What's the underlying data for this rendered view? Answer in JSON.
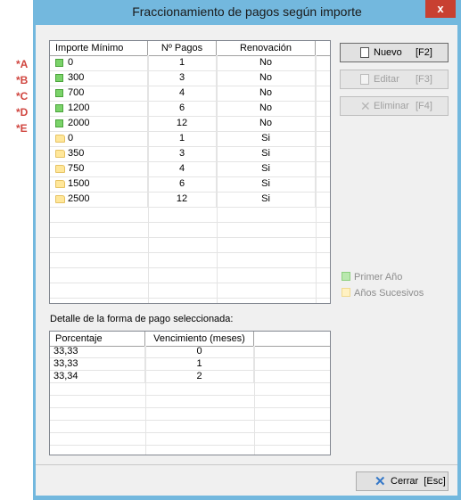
{
  "annotations": [
    "*A",
    "*B",
    "*C",
    "*D",
    "*E"
  ],
  "window": {
    "title": "Fraccionamiento de pagos según importe",
    "close_glyph": "x"
  },
  "plans": {
    "columns": [
      "Importe Mínimo",
      "Nº Pagos",
      "Renovación"
    ],
    "rows": [
      {
        "icon": "green",
        "importe": "0",
        "pagos": "1",
        "renovacion": "No"
      },
      {
        "icon": "green",
        "importe": "300",
        "pagos": "3",
        "renovacion": "No"
      },
      {
        "icon": "green",
        "importe": "700",
        "pagos": "4",
        "renovacion": "No"
      },
      {
        "icon": "green",
        "importe": "1200",
        "pagos": "6",
        "renovacion": "No"
      },
      {
        "icon": "green",
        "importe": "2000",
        "pagos": "12",
        "renovacion": "No"
      },
      {
        "icon": "folder",
        "importe": "0",
        "pagos": "1",
        "renovacion": "Si"
      },
      {
        "icon": "folder",
        "importe": "350",
        "pagos": "3",
        "renovacion": "Si"
      },
      {
        "icon": "folder",
        "importe": "750",
        "pagos": "4",
        "renovacion": "Si"
      },
      {
        "icon": "folder",
        "importe": "1500",
        "pagos": "6",
        "renovacion": "Si"
      },
      {
        "icon": "folder",
        "importe": "2500",
        "pagos": "12",
        "renovacion": "Si"
      }
    ]
  },
  "buttons": {
    "nuevo": {
      "label": "Nuevo",
      "key": "[F2]"
    },
    "editar": {
      "label": "Editar",
      "key": "[F3]"
    },
    "eliminar": {
      "label": "Eliminar",
      "key": "[F4]"
    },
    "cerrar": {
      "label": "Cerrar",
      "key": "[Esc]"
    }
  },
  "legend": {
    "first_year": "Primer Año",
    "next_years": "Años Sucesivos",
    "colors": {
      "green": "#7bd36a",
      "folder": "#ffe79a"
    }
  },
  "detail": {
    "caption": "Detalle de la forma de pago seleccionada:",
    "columns": [
      "Porcentaje",
      "Vencimiento (meses)"
    ],
    "rows": [
      {
        "porcentaje": "33,33",
        "vencimiento": "0"
      },
      {
        "porcentaje": "33,33",
        "vencimiento": "1"
      },
      {
        "porcentaje": "33,34",
        "vencimiento": "2"
      }
    ]
  }
}
